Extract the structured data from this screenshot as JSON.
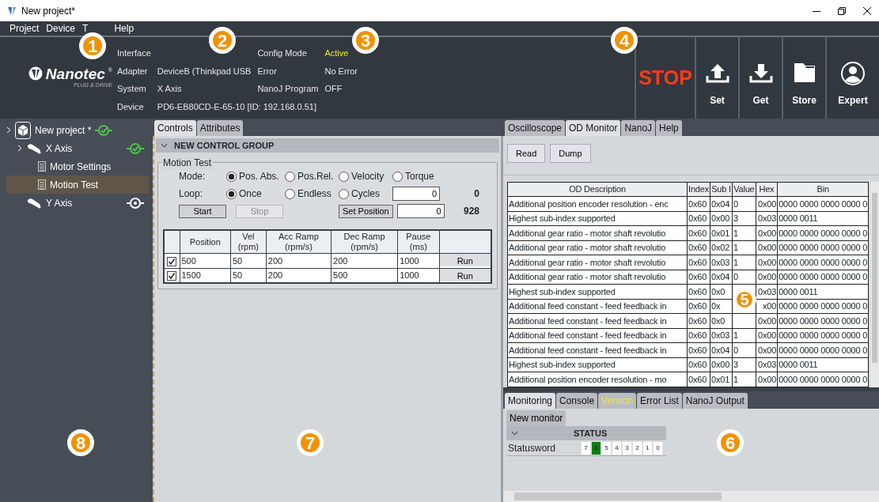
{
  "window": {
    "title": "New project*"
  },
  "menu": [
    "Project",
    "Device",
    "T",
    "Help"
  ],
  "logo": {
    "name": "Nanotec",
    "mark": "®",
    "tagline": "PLUG & DRIVE"
  },
  "info": [
    {
      "label": "Interface",
      "label2": "Config Mode",
      "value2": "Active",
      "active": true
    },
    {
      "label": "Adapter",
      "value": "DeviceB (Thinkpad USB",
      "label2": "Error",
      "value2": "No Error",
      "active": false
    },
    {
      "label": "System",
      "value": "X Axis",
      "label2": "NanoJ Program",
      "value2": "OFF",
      "active": false
    },
    {
      "label": "Device",
      "value": "PD6-EB80CD-E-65-10 [ID: 192.168.0.51]"
    }
  ],
  "stop": "STOP",
  "toolbar": [
    {
      "label": "Set",
      "kind": "upload"
    },
    {
      "label": "Get",
      "kind": "download"
    },
    {
      "label": "Store",
      "kind": "folder"
    },
    {
      "label": "Expert",
      "kind": "user"
    }
  ],
  "tree": [
    {
      "label": "New project *",
      "kind": "project",
      "connected": true,
      "selected": false,
      "children": [
        {
          "label": "X Axis",
          "kind": "axis",
          "connected": true,
          "selected": false,
          "children": [
            {
              "label": "Motor Settings",
              "kind": "page",
              "selected": false
            },
            {
              "label": "Motion Test",
              "kind": "page",
              "selected": true
            }
          ]
        },
        {
          "label": "Y Axis",
          "kind": "axis",
          "connected": false,
          "selected": false
        }
      ]
    }
  ],
  "controls": {
    "tabs": [
      {
        "label": "Controls",
        "selected": true
      },
      {
        "label": "Attributes",
        "selected": false
      }
    ],
    "group": "NEW CONTROL GROUP",
    "fieldset": "Motion Test",
    "mode": {
      "label": "Mode:",
      "options": [
        {
          "label": "Pos. Abs.",
          "selected": true
        },
        {
          "label": "Pos.Rel.",
          "selected": false
        },
        {
          "label": "Velocity",
          "selected": false
        },
        {
          "label": "Torque",
          "selected": false
        }
      ]
    },
    "loop": {
      "label": "Loop:",
      "options": [
        {
          "label": "Once",
          "selected": true
        },
        {
          "label": "Endless",
          "selected": false
        },
        {
          "label": "Cycles",
          "selected": false
        }
      ],
      "input": "0",
      "readout": "0"
    },
    "start": {
      "label": "Start",
      "disabled": false
    },
    "stop": {
      "label": "Stop",
      "disabled": true
    },
    "set_position": {
      "label": "Set Position",
      "input": "0",
      "readout": "928"
    },
    "table": {
      "columns": [
        "Position",
        "Vel\n(rpm)",
        "Acc Ramp\n(rpm/s)",
        "Dec Ramp\n(rpm/s)",
        "Pause\n(ms)"
      ],
      "rows": [
        {
          "checked": true,
          "cells": [
            "500",
            "50",
            "200",
            "200",
            "1000"
          ],
          "action": "Run"
        },
        {
          "checked": true,
          "cells": [
            "1500",
            "50",
            "200",
            "500",
            "1000"
          ],
          "action": "Run"
        }
      ]
    }
  },
  "od": {
    "tabs": [
      {
        "label": "Oscilloscope",
        "selected": false
      },
      {
        "label": "OD Monitor",
        "selected": true
      },
      {
        "label": "NanoJ",
        "selected": false
      },
      {
        "label": "Help",
        "selected": false
      }
    ],
    "buttons": [
      "Read",
      "Dump"
    ],
    "columns": [
      "OD Description",
      "Index",
      "Sub I",
      "Value",
      "Hex",
      "Bin"
    ],
    "rows": [
      [
        "Additional position encoder resolution - enc",
        "0x60",
        "0x04",
        "0",
        "0x00",
        "0000 0000 0000 0000 0"
      ],
      [
        "Highest sub-index supported",
        "0x60",
        "0x00",
        "3",
        "0x03",
        "0000 0011"
      ],
      [
        "Additional gear ratio - motor shaft revolutio",
        "0x60",
        "0x01",
        "1",
        "0x00",
        "0000 0000 0000 0000 0"
      ],
      [
        "Additional gear ratio - motor shaft revolutio",
        "0x60",
        "0x02",
        "1",
        "0x00",
        "0000 0000 0000 0000 0"
      ],
      [
        "Additional gear ratio - motor shaft revolutio",
        "0x60",
        "0x03",
        "1",
        "0x00",
        "0000 0000 0000 0000 0"
      ],
      [
        "Additional gear ratio - motor shaft revolutio",
        "0x60",
        "0x04",
        "0",
        "0x00",
        "0000 0000 0000 0000 0"
      ],
      [
        "Highest sub-index supported",
        "0x60",
        "0x0",
        null,
        "0x03",
        "0000 0011"
      ],
      [
        "Additional feed constant - feed feedback in",
        "0x60",
        "0x",
        null,
        "x00",
        "0000 0000 0000 0000 0"
      ],
      [
        "Additional feed constant - feed feedback in",
        "0x60",
        "0x0",
        null,
        "0x00",
        "0000 0000 0000 0000 0"
      ],
      [
        "Additional feed constant - feed feedback in",
        "0x60",
        "0x03",
        "1",
        "0x00",
        "0000 0000 0000 0000 0"
      ],
      [
        "Additional feed constant - feed feedback in",
        "0x60",
        "0x04",
        "0",
        "0x00",
        "0000 0000 0000 0000 0"
      ],
      [
        "Highest sub-index supported",
        "0x60",
        "0x00",
        "3",
        "0x03",
        "0000 0011"
      ],
      [
        "Additional position encoder resolution - mo",
        "0x60",
        "0x01",
        "1",
        "0x00",
        "0000 0000 0000 0000 0"
      ]
    ]
  },
  "monitor": {
    "tabs": [
      {
        "label": "Monitoring",
        "selected": true,
        "highlight": false
      },
      {
        "label": "Console",
        "selected": false,
        "highlight": false
      },
      {
        "label": "Version",
        "selected": false,
        "highlight": true
      },
      {
        "label": "Error List",
        "selected": false,
        "highlight": false
      },
      {
        "label": "NanoJ Output",
        "selected": false,
        "highlight": false
      }
    ],
    "subtab": "New monitor",
    "group": "STATUS",
    "signal": "Statusword",
    "bits": [
      {
        "label": "7",
        "on": false
      },
      {
        "label": "6",
        "on": true
      },
      {
        "label": "5",
        "on": false
      },
      {
        "label": "4",
        "on": false
      },
      {
        "label": "3",
        "on": false
      },
      {
        "label": "2",
        "on": false
      },
      {
        "label": "1",
        "on": false
      },
      {
        "label": "0",
        "on": false
      }
    ]
  },
  "callouts": [
    "1",
    "2",
    "3",
    "4",
    "5",
    "8",
    "7",
    "6"
  ]
}
